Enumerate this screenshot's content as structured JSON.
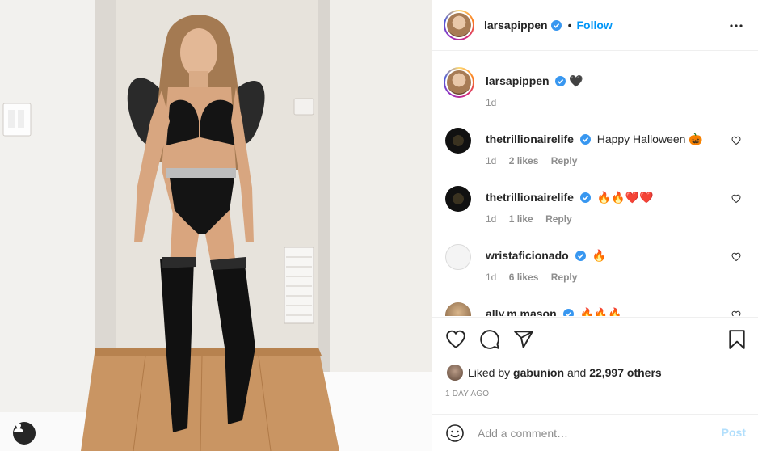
{
  "header": {
    "username": "larsapippen",
    "separator": "•",
    "follow_label": "Follow",
    "more_icon": "more-horizontal-icon"
  },
  "caption": {
    "username": "larsapippen",
    "text": "🖤",
    "age": "1d"
  },
  "comments": [
    {
      "username": "thetrillionairelife",
      "text": "Happy Halloween 🎃",
      "age": "1d",
      "likes": "2 likes",
      "reply": "Reply",
      "avatar": "dark"
    },
    {
      "username": "thetrillionairelife",
      "text": "🔥🔥❤️❤️",
      "age": "1d",
      "likes": "1 like",
      "reply": "Reply",
      "avatar": "dark"
    },
    {
      "username": "wristaficionado",
      "text": "🔥",
      "age": "1d",
      "likes": "6 likes",
      "reply": "Reply",
      "avatar": "light"
    },
    {
      "username": "ally.m.mason",
      "text": "🔥🔥🔥",
      "age": "",
      "likes": "",
      "reply": "",
      "avatar": "tan"
    }
  ],
  "actions": {
    "icons": [
      "heart-icon",
      "comment-icon",
      "share-icon",
      "bookmark-icon"
    ]
  },
  "likes": {
    "prefix": "Liked by",
    "user": "gabunion",
    "conj": "and",
    "others": "22,997 others"
  },
  "date": "1 DAY AGO",
  "add_comment": {
    "placeholder": "Add a comment…",
    "post_label": "Post"
  },
  "colors": {
    "link_blue": "#0095f6",
    "post_disabled": "#b2dffc",
    "meta_gray": "#8e8e8e"
  }
}
